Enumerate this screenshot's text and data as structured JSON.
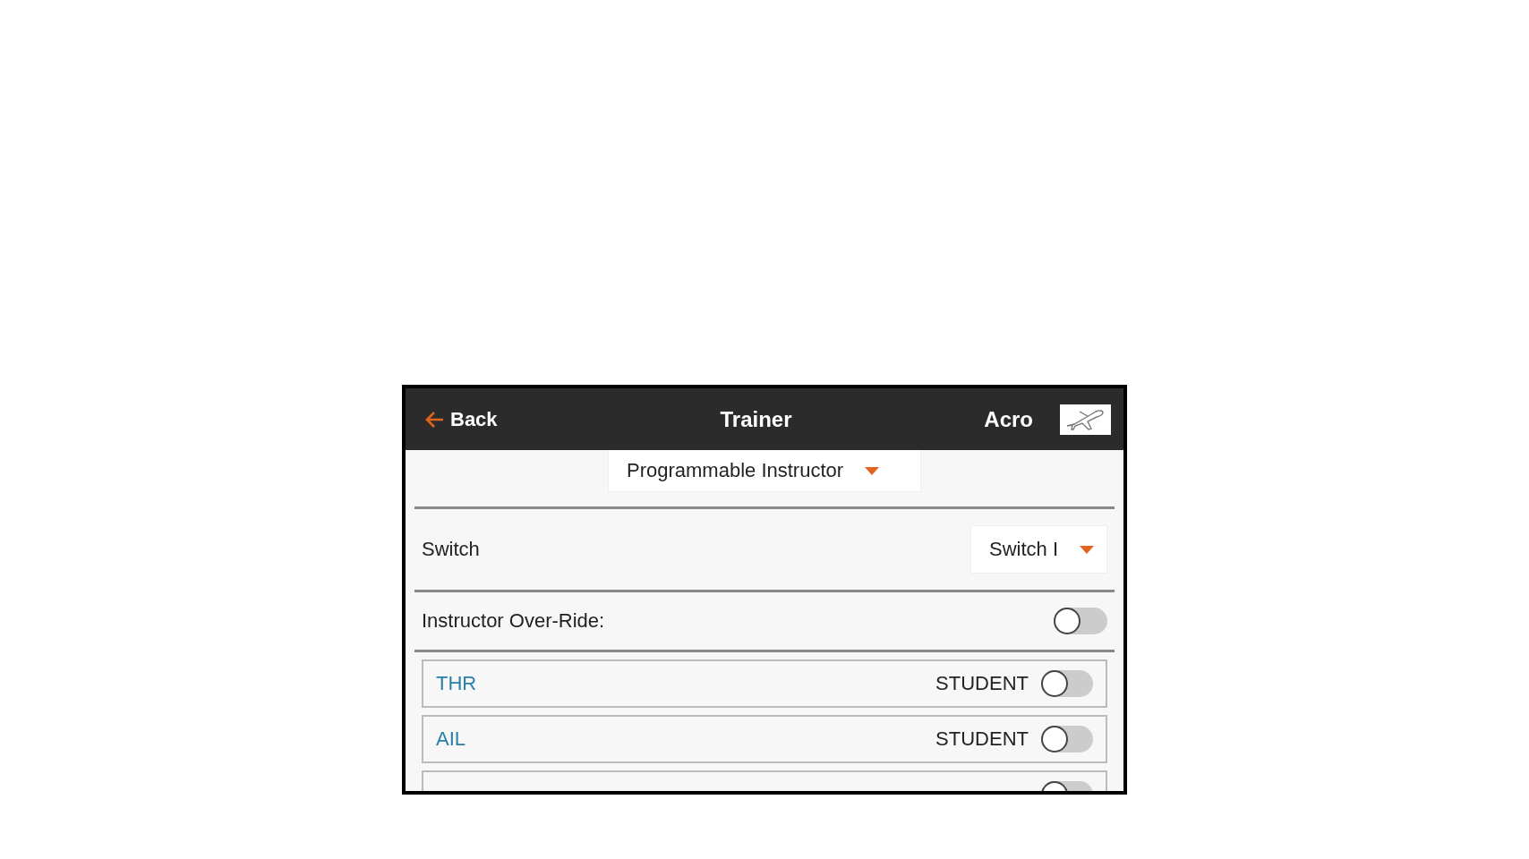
{
  "header": {
    "back": "Back",
    "title": "Trainer",
    "model": "Acro"
  },
  "mode": {
    "value": "Programmable Instructor"
  },
  "switch": {
    "label": "Switch",
    "value": "Switch I"
  },
  "override": {
    "label": "Instructor Over-Ride:",
    "on": false
  },
  "channels": [
    {
      "label": "THR",
      "state": "STUDENT",
      "on": false
    },
    {
      "label": "AIL",
      "state": "STUDENT",
      "on": false
    },
    {
      "on": false
    }
  ]
}
